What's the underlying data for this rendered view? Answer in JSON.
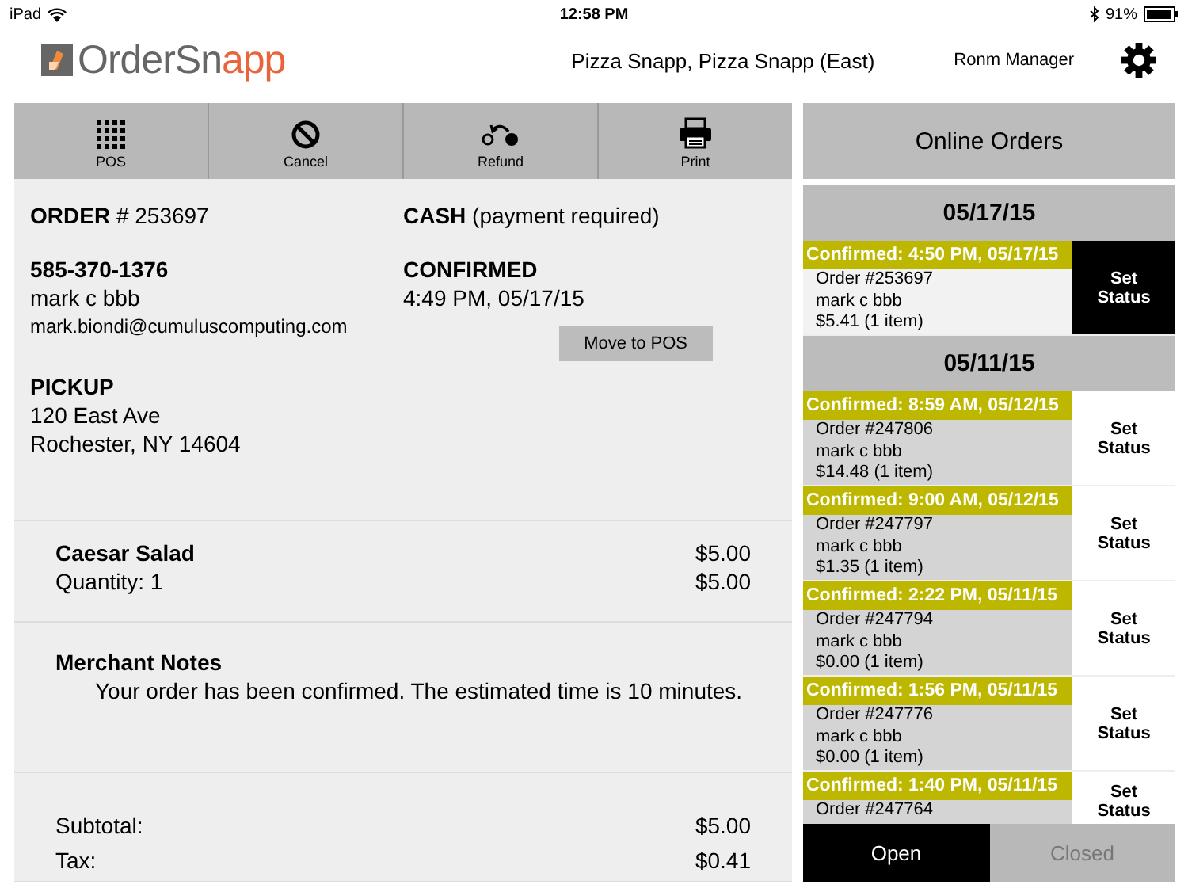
{
  "status_bar": {
    "device": "iPad",
    "time": "12:58 PM",
    "battery": "91%"
  },
  "header": {
    "logo": {
      "part_1": "OrderSn",
      "part_2": "app"
    },
    "store": "Pizza Snapp, Pizza Snapp (East)",
    "user": "Ronm Manager"
  },
  "toolbar": [
    {
      "label": "POS",
      "kind": "grid"
    },
    {
      "label": "Cancel",
      "kind": "cancel"
    },
    {
      "label": "Refund",
      "kind": "refund"
    },
    {
      "label": "Print",
      "kind": "print"
    }
  ],
  "order": {
    "number": "**ORDER** # 253697",
    "payment": "**CASH** (payment required)",
    "phone": "585-370-1376",
    "name": "mark c bbb",
    "email": "mark.biondi@cumuluscomputing.com",
    "status": "CONFIRMED",
    "status_time": "4:49 PM, 05/17/15",
    "move_button": "Move to POS",
    "method": "PICKUP",
    "address": [
      "120 East Ave",
      "Rochester, NY 14604"
    ]
  },
  "items": [
    {
      "name": "Caesar Salad",
      "quantity": "Quantity: 1",
      "price": "$5.00",
      "total": "$5.00"
    }
  ],
  "notes": {
    "title": "Merchant Notes",
    "text": "Your order has been confirmed.  The estimated time is 10 minutes."
  },
  "totals": [
    {
      "label": "Subtotal:",
      "value": "$5.00"
    },
    {
      "label": "Tax:",
      "value": "$0.41"
    }
  ],
  "online_orders": {
    "title": "Online Orders",
    "groups": [
      {
        "date": "05/17/15",
        "orders": [
          {
            "confirmed": "Confirmed: 4:50 PM, 05/17/15",
            "order": "Order #253697",
            "name": "mark c bbb",
            "amount": "$5.41 (1 item)",
            "action": "Set Status",
            "selected": true
          }
        ]
      },
      {
        "date": "05/11/15",
        "orders": [
          {
            "confirmed": "Confirmed: 8:59 AM, 05/12/15",
            "order": "Order #247806",
            "name": "mark c bbb",
            "amount": "$14.48 (1 item)",
            "action": "Set Status",
            "selected": false
          },
          {
            "confirmed": "Confirmed: 9:00 AM, 05/12/15",
            "order": "Order #247797",
            "name": "mark c bbb",
            "amount": "$1.35 (1 item)",
            "action": "Set Status",
            "selected": false
          },
          {
            "confirmed": "Confirmed: 2:22 PM, 05/11/15",
            "order": "Order #247794",
            "name": "mark c bbb",
            "amount": "$0.00 (1 item)",
            "action": "Set Status",
            "selected": false
          },
          {
            "confirmed": "Confirmed: 1:56 PM, 05/11/15",
            "order": "Order #247776",
            "name": "mark c bbb",
            "amount": "$0.00 (1 item)",
            "action": "Set Status",
            "selected": false
          },
          {
            "confirmed": "Confirmed: 1:40 PM, 05/11/15",
            "order": "Order #247764",
            "action": "Set Status",
            "selected": false
          }
        ]
      }
    ],
    "tabs": [
      {
        "label": "Open",
        "selected": true
      },
      {
        "label": "Closed",
        "selected": false
      }
    ]
  }
}
